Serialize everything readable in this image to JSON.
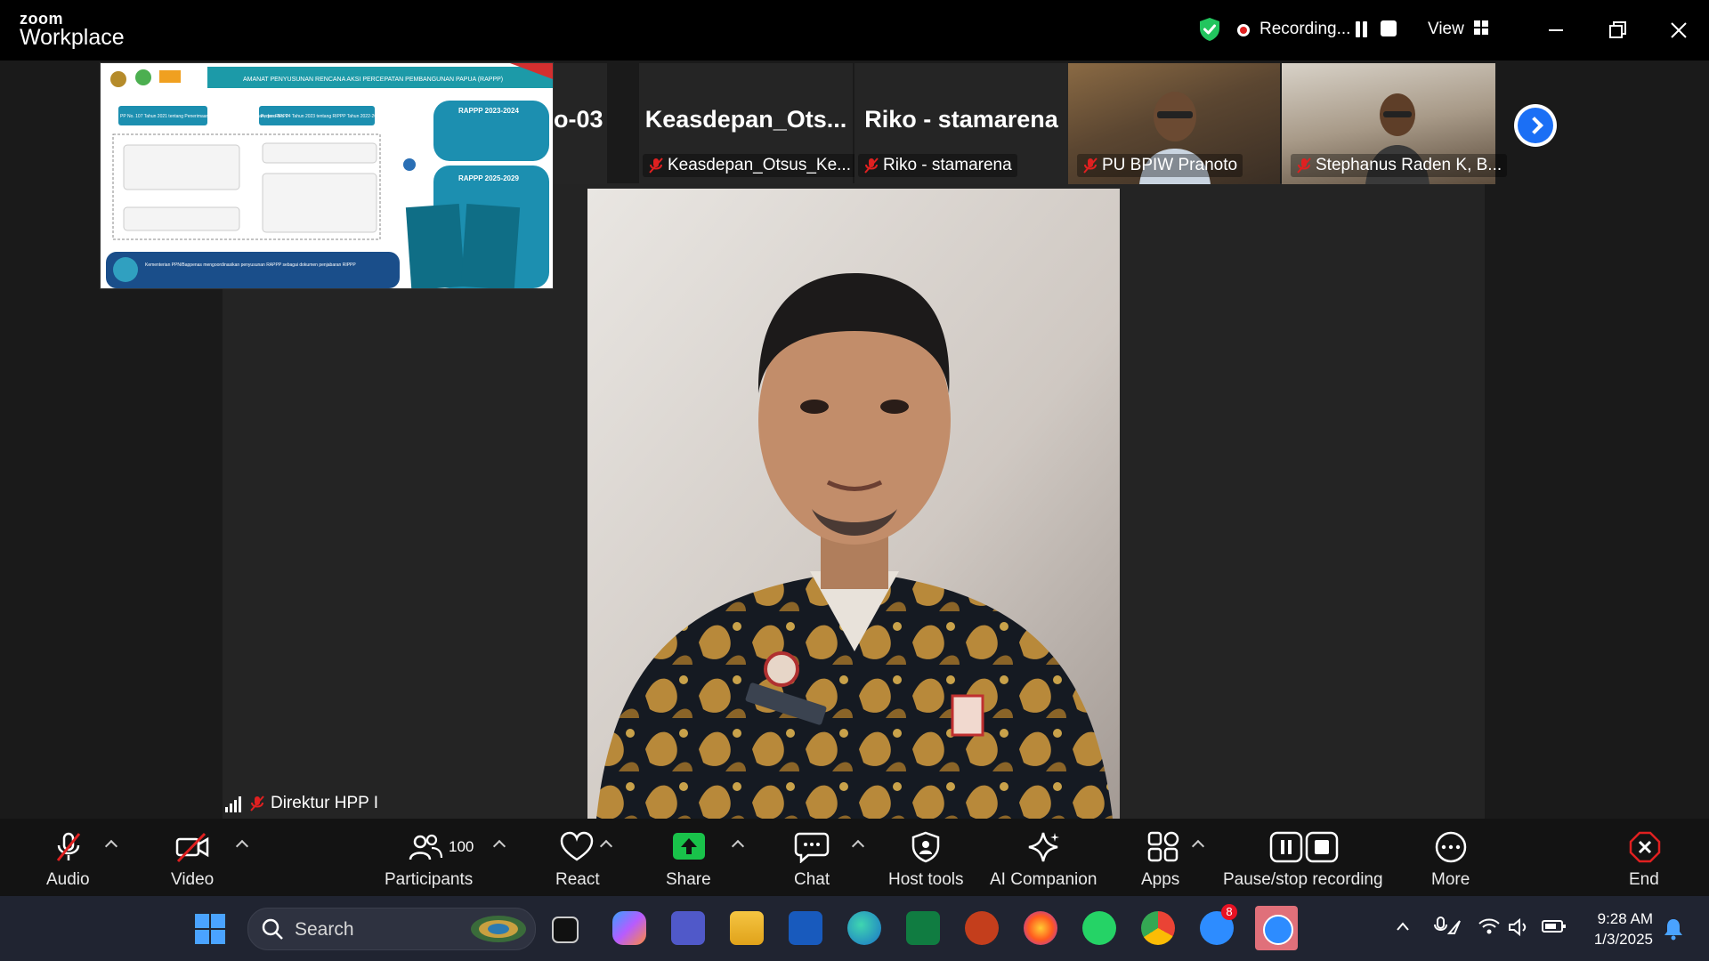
{
  "app": {
    "logo_line1": "zoom",
    "logo_line2": "Workplace"
  },
  "recording": {
    "status_text": "Recording...",
    "view_label": "View"
  },
  "participants_strip": [
    {
      "big_label": "o-03",
      "name": ""
    },
    {
      "big_label": "Keasdepan_Ots...",
      "name": "Keasdepan_Otsus_Ke..."
    },
    {
      "big_label": "Riko - stamarena",
      "name": "Riko - stamarena"
    },
    {
      "big_label": "",
      "name": "PU BPIW Pranoto"
    },
    {
      "big_label": "",
      "name": "Stephanus Raden K, B..."
    }
  ],
  "shared_slide": {
    "header": "AMANAT PENYUSUNAN RENCANA AKSI PERCEPATAN PEMBANGUNAN PAPUA (RAPPP)",
    "box1": "PP No. 107 Tahun 2021 tentang Penerimaan, Pengelolaan, Pengawasan, dan RIPPP",
    "box2": "Perpres No. 24 Tahun 2023 tentang RIPPP Tahun 2022-2041",
    "rappp1": "RAPPP 2023-2024",
    "rappp2": "RAPPP 2025-2029",
    "footer": "Kementerian PPN/Bappenas mengoordinasikan penyusunan RAPPP sebagai dokumen penjabaran RIPPP"
  },
  "active_speaker": {
    "name": "Direktur HPP I"
  },
  "toolbar": {
    "audio": "Audio",
    "video": "Video",
    "participants": "Participants",
    "participants_count": "100",
    "react": "React",
    "share": "Share",
    "chat": "Chat",
    "host_tools": "Host tools",
    "ai_companion": "AI Companion",
    "apps": "Apps",
    "pause_stop": "Pause/stop recording",
    "more": "More",
    "end": "End"
  },
  "taskbar": {
    "search_placeholder": "Search",
    "zoom_badge": "8",
    "time": "9:28 AM",
    "date": "1/3/2025"
  },
  "colors": {
    "accent_blue": "#1b6ff5",
    "share_green": "#19c24a",
    "record_red": "#e02020",
    "shield_green": "#22c55e"
  }
}
